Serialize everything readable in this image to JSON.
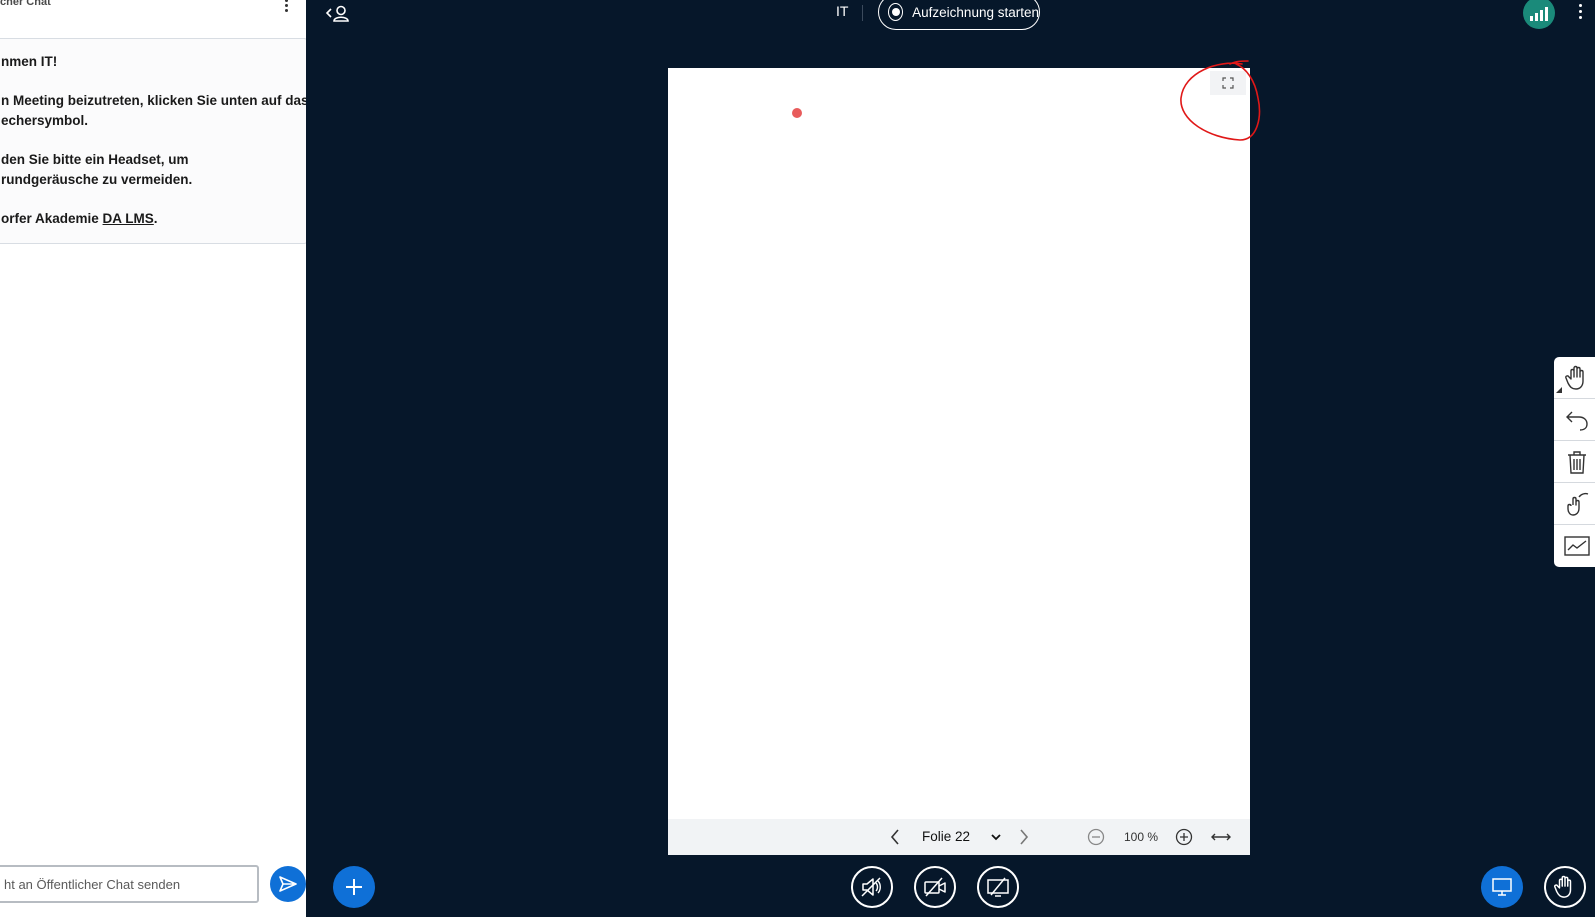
{
  "chat": {
    "title": "cher Chat",
    "welcome": {
      "line1": "nmen IT!",
      "line2a": "n Meeting beizutreten, klicken Sie unten auf das",
      "line2b": "echersymbol.",
      "line3a": "den Sie bitte ein Headset, um",
      "line3b": "rundgeräusche zu vermeiden.",
      "line4_prefix": "orfer Akademie ",
      "line4_link": "DA LMS",
      "line4_suffix": "."
    },
    "input_placeholder": "ht an Öffentlicher Chat senden"
  },
  "header": {
    "meeting_name": "IT",
    "record_label": "Aufzeichnung starten"
  },
  "presentation": {
    "slide_label": "Folie 22",
    "zoom": "100 %"
  },
  "whiteboard_tools": [
    "hand-tool",
    "undo",
    "clear-all",
    "multi-user",
    "pen-tool"
  ],
  "colors": {
    "background": "#06172a",
    "accent": "#0f70d7",
    "connection": "#1a8a7a",
    "pointer": "#e85b5b",
    "annotation": "#e01818"
  }
}
